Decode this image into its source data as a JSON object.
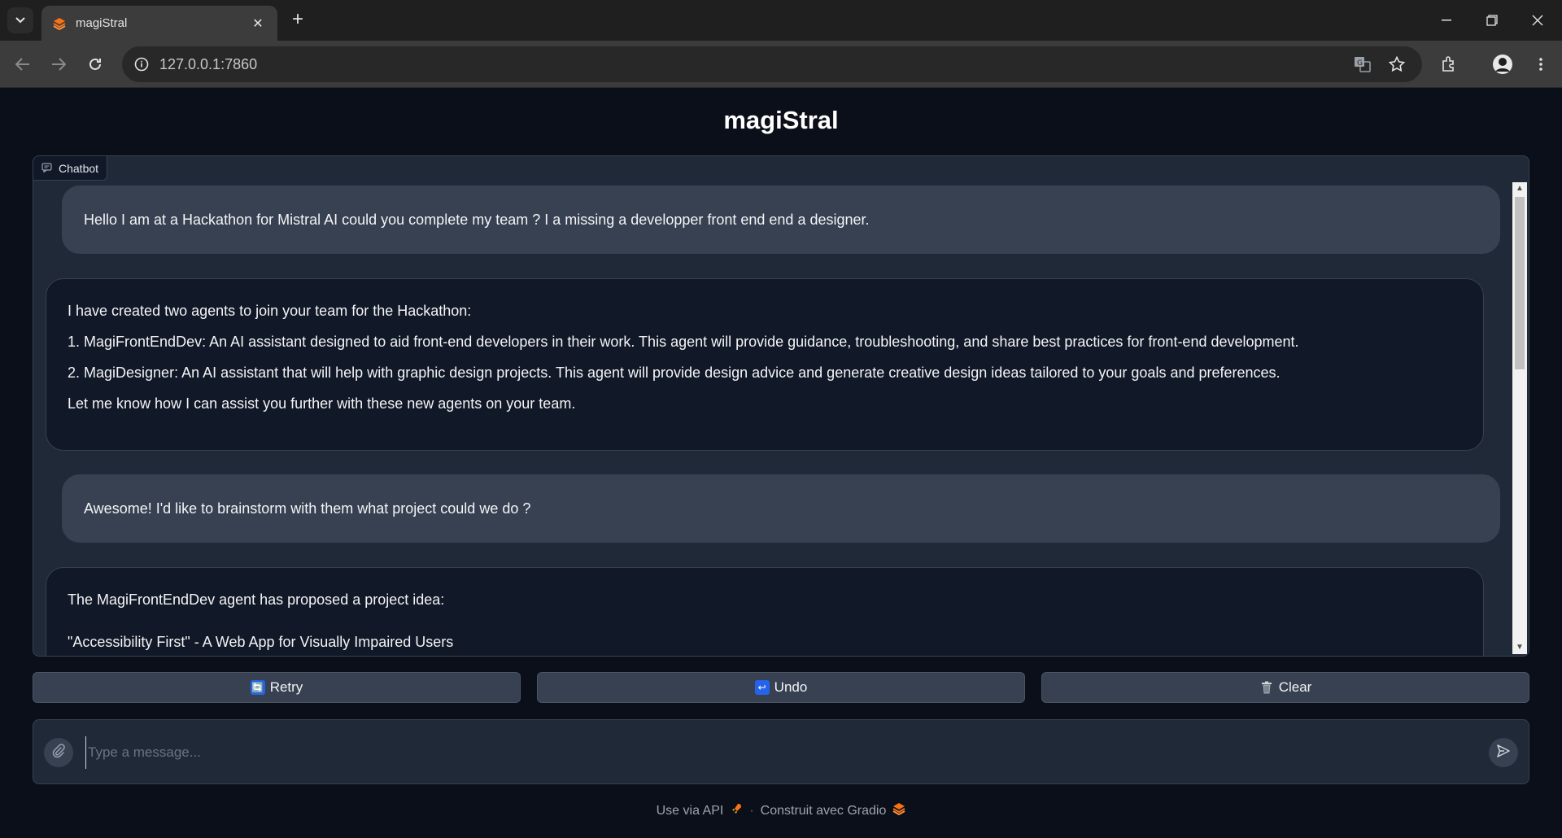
{
  "browser": {
    "tab_title": "magiStral",
    "url": "127.0.0.1:7860"
  },
  "app": {
    "title": "magiStral",
    "chatbot_label": "Chatbot",
    "messages": [
      {
        "role": "user",
        "text": "Hello I am at a Hackathon for Mistral AI could you complete my team ? I a missing a developper front end end a designer."
      },
      {
        "role": "assistant",
        "intro": "I have created two agents to join your team for the Hackathon:",
        "items": [
          "1. MagiFrontEndDev: An AI assistant designed to aid front-end developers in their work. This agent will provide guidance, troubleshooting, and share best practices for front-end development.",
          "2. MagiDesigner: An AI assistant that will help with graphic design projects. This agent will provide design advice and generate creative design ideas tailored to your goals and preferences."
        ],
        "outro": "Let me know how I can assist you further with these new agents on your team."
      },
      {
        "role": "user",
        "text": "Awesome! I'd like to brainstorm with them what project could we do ?"
      },
      {
        "role": "assistant",
        "intro": "The MagiFrontEndDev agent has proposed a project idea:",
        "line2": "\"Accessibility First\" - A Web App for Visually Impaired Users"
      }
    ],
    "buttons": {
      "retry": "Retry",
      "undo": "Undo",
      "clear": "Clear"
    },
    "input_placeholder": "Type a message...",
    "footer": {
      "api": "Use via API",
      "separator": "·",
      "built_with": "Construit avec Gradio"
    }
  },
  "colors": {
    "background": "#0b0f19",
    "panel": "#1f2937",
    "user_bubble": "#374151",
    "bot_bubble": "#111827",
    "accent": "#f97316"
  }
}
